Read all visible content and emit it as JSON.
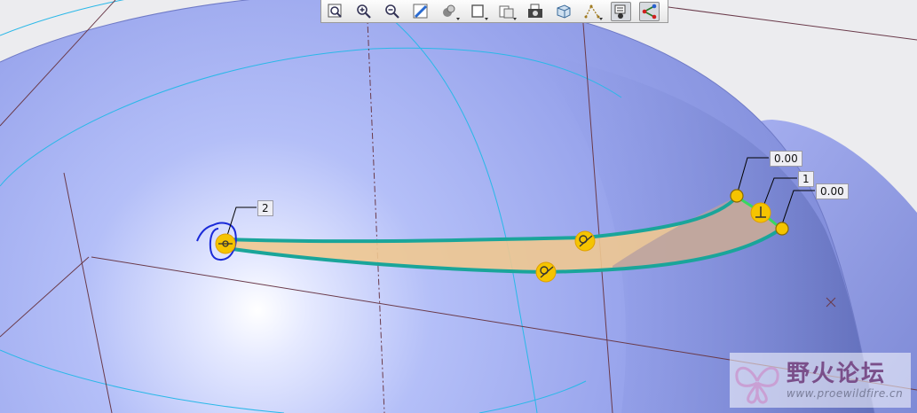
{
  "toolbar": {
    "buttons": [
      {
        "icon": "zoom-fit-icon",
        "label": "Refit"
      },
      {
        "icon": "zoom-in-icon",
        "label": "Zoom In"
      },
      {
        "icon": "zoom-out-icon",
        "label": "Zoom Out"
      },
      {
        "icon": "repaint-icon",
        "label": "Repaint"
      },
      {
        "icon": "display-style-icon",
        "label": "Display Style"
      },
      {
        "icon": "saved-orientations-icon",
        "label": "Saved Orientations"
      },
      {
        "icon": "view-manager-icon",
        "label": "View Manager"
      },
      {
        "icon": "camera-icon",
        "label": "Capture"
      },
      {
        "icon": "perspective-icon",
        "label": "Perspective View"
      },
      {
        "icon": "datum-display-icon",
        "label": "Datum Display"
      },
      {
        "icon": "annotation-display-icon",
        "label": "Annotation Display",
        "active": true
      },
      {
        "icon": "spin-center-icon",
        "label": "Spin Center",
        "active": true
      }
    ]
  },
  "dimensions": {
    "top_left_tangent": "0.00",
    "perpendicular": "1",
    "right_tangent": "0.00",
    "left_endpoint": "2"
  },
  "watermark": {
    "title": "野火论坛",
    "url": "www.proewildfire.cn"
  },
  "colors": {
    "surface": "#9aa6ee",
    "surface_highlight": "#ffffff",
    "curve": "#1aa59a",
    "fill_region": "#f0c890",
    "handle": "#f5c400",
    "sketch_circle": "#1a2ad8",
    "datum_line": "#6a3a4a",
    "axis_line": "#2ab8e8"
  }
}
